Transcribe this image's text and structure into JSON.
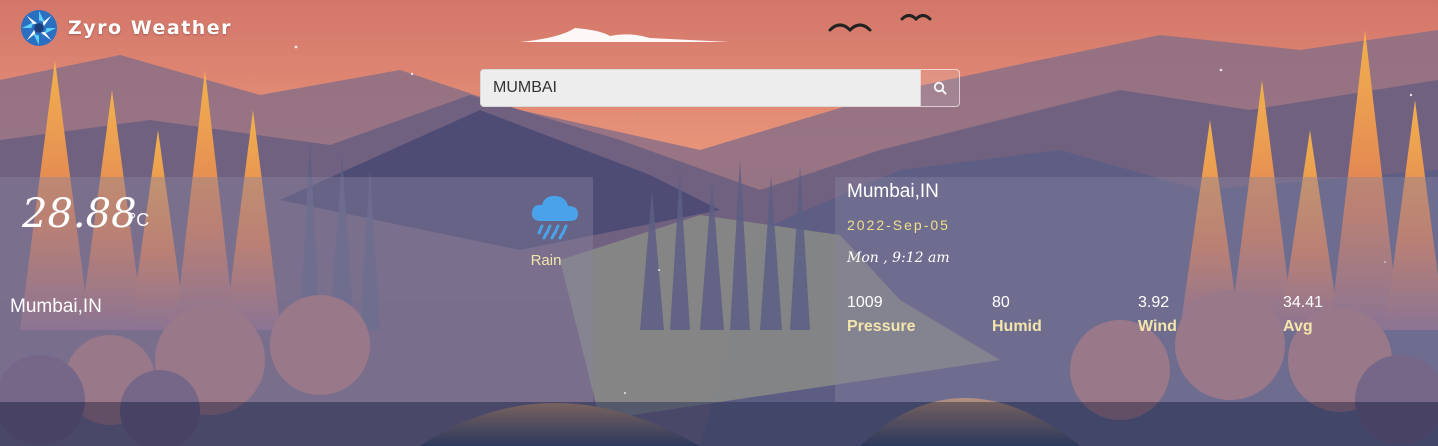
{
  "app": {
    "title": "Zyro Weather"
  },
  "search": {
    "value": "MUMBAI",
    "button_icon": "search-icon"
  },
  "current": {
    "temperature": "28.88",
    "unit": "°C",
    "condition": "Rain",
    "condition_icon": "cloud-rain-icon",
    "location": "Mumbai,IN"
  },
  "details": {
    "location": "Mumbai,IN",
    "date": "2022-Sep-05",
    "day_time": "Mon , 9:12 am",
    "stats": [
      {
        "value": "1009",
        "label": "Pressure"
      },
      {
        "value": "80",
        "label": "Humid"
      },
      {
        "value": "3.92",
        "label": "Wind"
      },
      {
        "value": "34.41",
        "label": "Avg"
      }
    ]
  },
  "colors": {
    "accent_label": "#f3e6ad",
    "date": "#f0df8a",
    "rain_icon": "#4aa3ea"
  }
}
